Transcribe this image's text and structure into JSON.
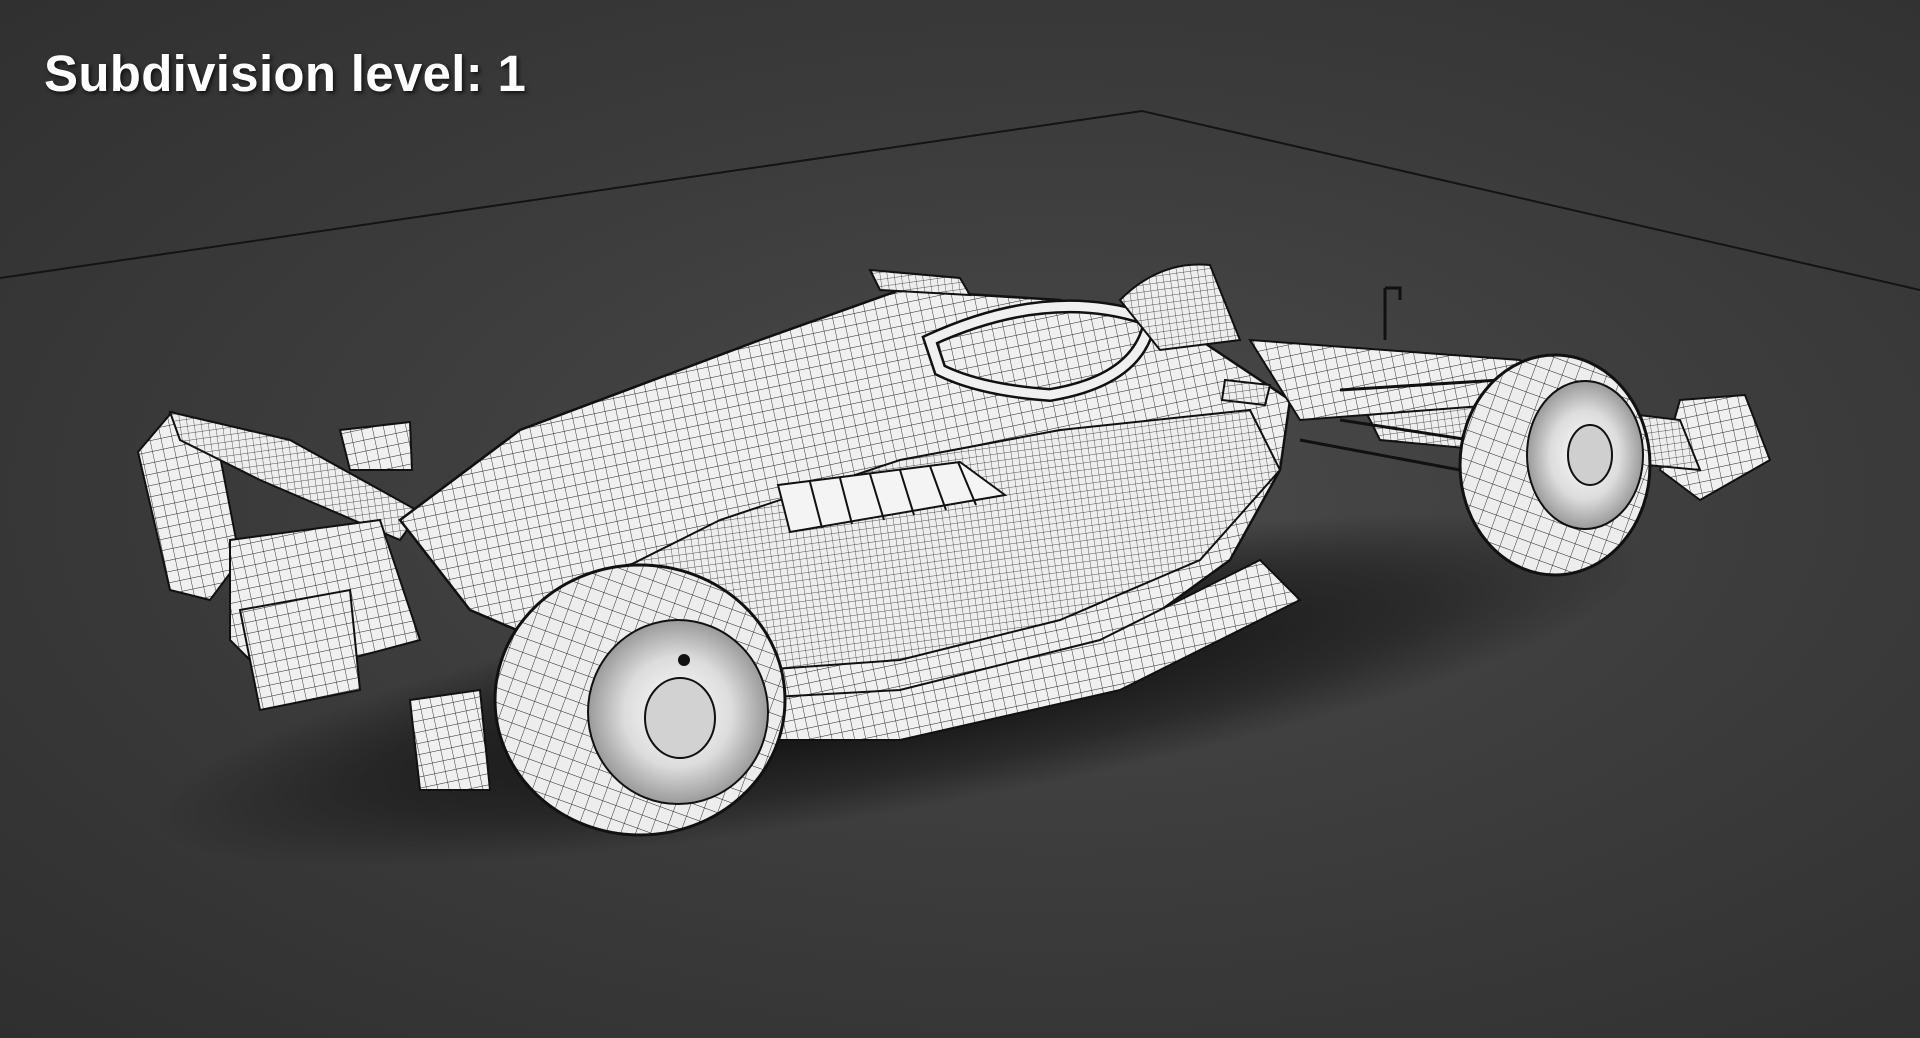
{
  "viewport": {
    "overlay_label": "Subdivision level: 1"
  },
  "scene": {
    "subject": "formula-1-car-wireframe-model",
    "shading": "white clay with black wireframe grid",
    "background_color": "#3d3d3d",
    "wire_color": "#1a1a1a",
    "body_color": "#f2f2f2"
  }
}
